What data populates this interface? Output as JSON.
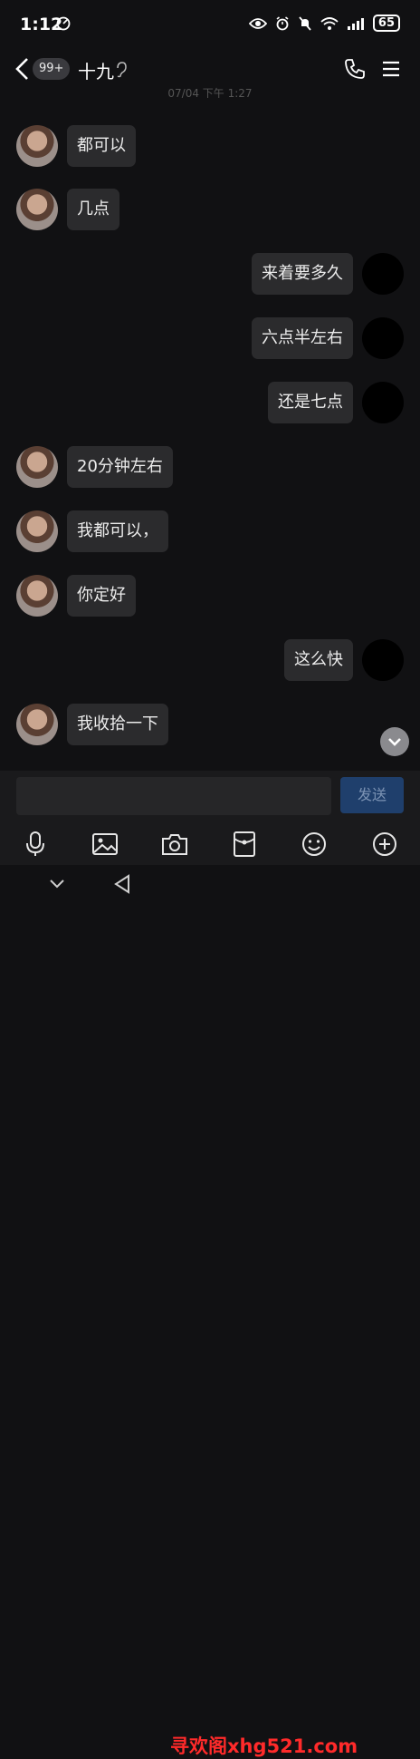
{
  "status": {
    "time": "1:12",
    "battery": "65"
  },
  "header": {
    "badge": "99+",
    "contact": "十九"
  },
  "timestamp": "07/04 下午 1:27",
  "messages": [
    {
      "side": "in",
      "text": "都可以"
    },
    {
      "side": "in",
      "text": "几点"
    },
    {
      "side": "out",
      "text": "来着要多久"
    },
    {
      "side": "out",
      "text": "六点半左右"
    },
    {
      "side": "out",
      "text": "还是七点"
    },
    {
      "side": "in",
      "text": "20分钟左右"
    },
    {
      "side": "in",
      "text": "我都可以，"
    },
    {
      "side": "in",
      "text": "你定好"
    },
    {
      "side": "out",
      "text": "这么快"
    },
    {
      "side": "in",
      "text": "我收拾一下"
    }
  ],
  "composer": {
    "input_value": "",
    "send_label": "发送"
  },
  "toolbar": {
    "icons": [
      "microphone-icon",
      "image-icon",
      "camera-icon",
      "red-packet-icon",
      "emoji-icon",
      "plus-icon"
    ]
  },
  "watermark": "寻欢阁xhg521.com",
  "colors": {
    "background": "#111113",
    "bubble": "#2b2b2d",
    "send_button": "#1f3f6c",
    "watermark": "#ff2a2a"
  }
}
